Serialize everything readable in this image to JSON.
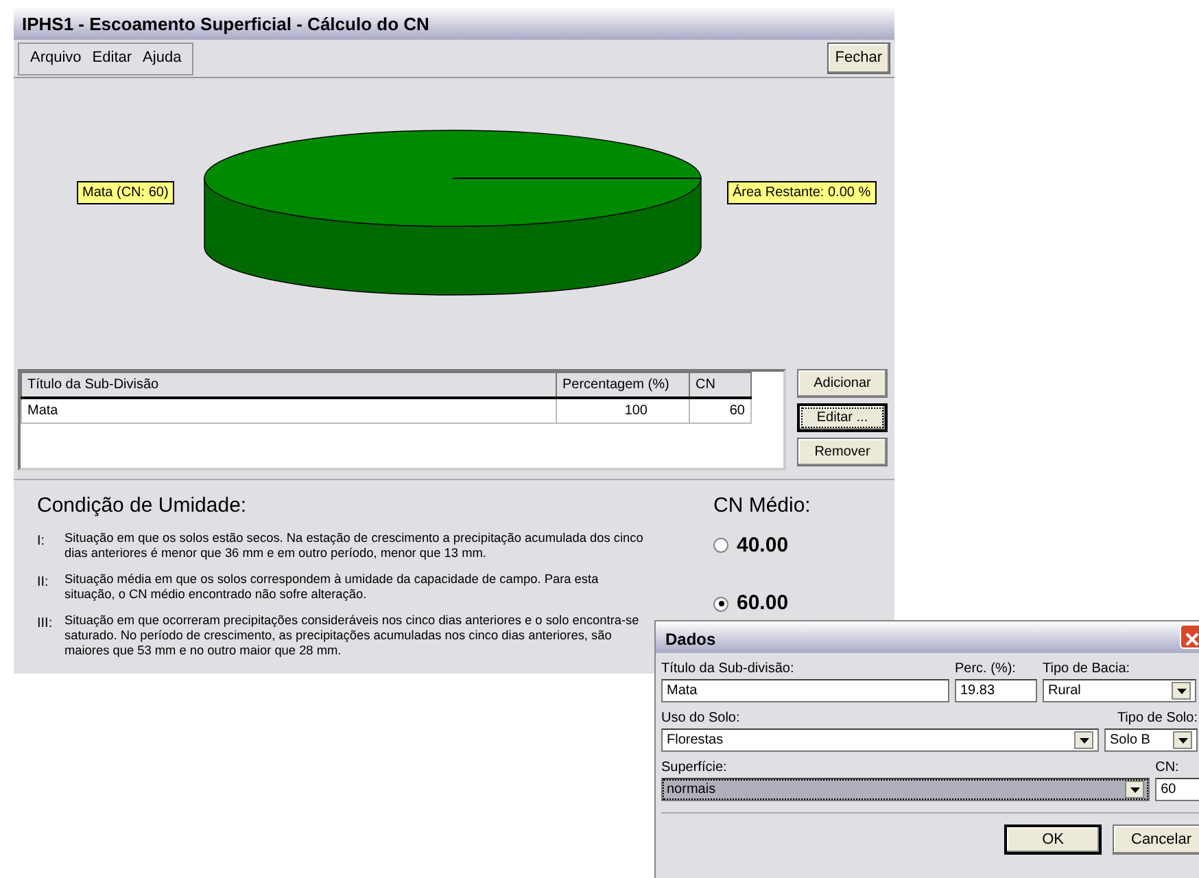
{
  "window": {
    "title": "IPHS1 - Escoamento Superficial - Cálculo do CN"
  },
  "menu": [
    "Arquivo",
    "Editar",
    "Ajuda"
  ],
  "close_button": "Fechar",
  "chart": {
    "labels": [
      "Mata  (CN: 60)",
      "Área Restante: 0.00 %"
    ]
  },
  "table": {
    "columns": [
      "Título da Sub-Divisão",
      "Percentagem (%)",
      "CN"
    ],
    "rows": [
      [
        "Mata",
        "100",
        "60"
      ]
    ]
  },
  "side_buttons": [
    {
      "label": "Adicionar",
      "focused": false
    },
    {
      "label": "Editar ...",
      "focused": true
    },
    {
      "label": "Remover",
      "focused": false
    }
  ],
  "moisture": {
    "title": "Condição de Umidade:",
    "items": [
      {
        "numeral": "I:",
        "text": "Situação em que os solos estão secos. Na estação de crescimento a precipitação acumulada dos cinco dias anteriores é menor que 36 mm e em outro período, menor que 13 mm."
      },
      {
        "numeral": "II:",
        "text": "Situação média em que os solos correspondem à umidade da capacidade de campo. Para esta situação, o CN médio encontrado não sofre alteração."
      },
      {
        "numeral": "III:",
        "text": "Situação em que ocorreram precipitações consideráveis nos cinco dias anteriores e o solo encontra-se saturado. No período de crescimento, as precipitações acumuladas nos cinco dias anteriores, são maiores que 53 mm e no outro maior que 28 mm."
      }
    ]
  },
  "cn_medio": {
    "title": "CN  Médio:",
    "options": [
      {
        "label": "40.00",
        "selected": false
      },
      {
        "label": "60.00",
        "selected": true
      }
    ]
  },
  "dialog": {
    "title": "Dados",
    "fields": [
      {
        "label": "Título da Sub-divisão:",
        "value": "Mata",
        "kind": "text",
        "focused": false
      },
      {
        "label": "Perc. (%):",
        "value": "19.83",
        "kind": "text",
        "focused": false
      },
      {
        "label": "Tipo de Bacia:",
        "value": "Rural",
        "kind": "select",
        "focused": false
      },
      {
        "label": "Uso do Solo:",
        "value": "Florestas",
        "kind": "select",
        "focused": false
      },
      {
        "label": "Tipo de Solo:",
        "value": "Solo B",
        "kind": "select",
        "focused": false
      },
      {
        "label": "Superfície:",
        "value": "normais",
        "kind": "select",
        "focused": true
      },
      {
        "label": "CN:",
        "value": "60",
        "kind": "text",
        "focused": false
      }
    ],
    "buttons": [
      {
        "label": "OK",
        "focused": true
      },
      {
        "label": "Cancelar",
        "focused": false
      }
    ]
  }
}
